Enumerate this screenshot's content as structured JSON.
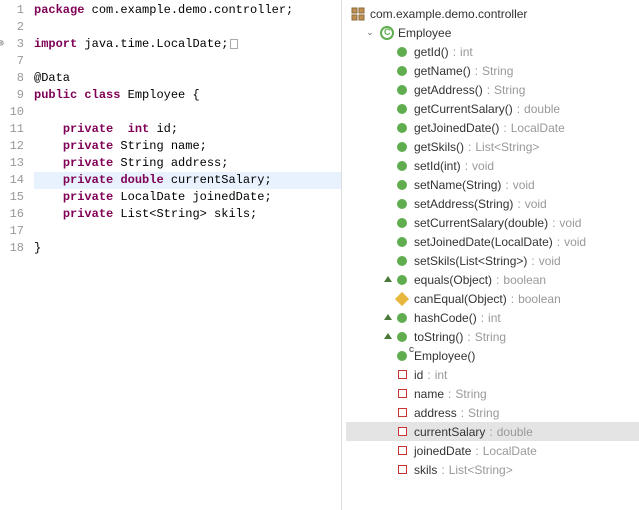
{
  "editor": {
    "lines": [
      {
        "n": "1",
        "tokens": [
          [
            "kw",
            "package"
          ],
          [
            "plain",
            " com.example.demo.controller;"
          ]
        ]
      },
      {
        "n": "2",
        "tokens": []
      },
      {
        "n": "3",
        "tokens": [
          [
            "kw",
            "import"
          ],
          [
            "plain",
            " java.time.LocalDate;"
          ]
        ],
        "import": true,
        "collapsed": true
      },
      {
        "n": "7",
        "tokens": []
      },
      {
        "n": "8",
        "tokens": [
          [
            "plain",
            "@Data"
          ]
        ]
      },
      {
        "n": "9",
        "tokens": [
          [
            "kw",
            "public"
          ],
          [
            "plain",
            " "
          ],
          [
            "kw",
            "class"
          ],
          [
            "plain",
            " Employee {"
          ]
        ]
      },
      {
        "n": "10",
        "tokens": []
      },
      {
        "n": "11",
        "tokens": [
          [
            "plain",
            "    "
          ],
          [
            "kw",
            "private"
          ],
          [
            "plain",
            "  "
          ],
          [
            "kw",
            "int"
          ],
          [
            "plain",
            " id;"
          ]
        ]
      },
      {
        "n": "12",
        "tokens": [
          [
            "plain",
            "    "
          ],
          [
            "kw",
            "private"
          ],
          [
            "plain",
            " String name;"
          ]
        ]
      },
      {
        "n": "13",
        "tokens": [
          [
            "plain",
            "    "
          ],
          [
            "kw",
            "private"
          ],
          [
            "plain",
            " String address;"
          ]
        ]
      },
      {
        "n": "14",
        "tokens": [
          [
            "plain",
            "    "
          ],
          [
            "kw",
            "private"
          ],
          [
            "plain",
            " "
          ],
          [
            "kw",
            "double"
          ],
          [
            "plain",
            " currentSalary;"
          ]
        ],
        "highlighted": true
      },
      {
        "n": "15",
        "tokens": [
          [
            "plain",
            "    "
          ],
          [
            "kw",
            "private"
          ],
          [
            "plain",
            " LocalDate joinedDate;"
          ]
        ]
      },
      {
        "n": "16",
        "tokens": [
          [
            "plain",
            "    "
          ],
          [
            "kw",
            "private"
          ],
          [
            "plain",
            " List<String> skils;"
          ]
        ]
      },
      {
        "n": "17",
        "tokens": []
      },
      {
        "n": "18",
        "tokens": [
          [
            "plain",
            "}"
          ]
        ]
      }
    ]
  },
  "outline": {
    "package": "com.example.demo.controller",
    "class": "Employee",
    "members": [
      {
        "icon": "method-public",
        "name": "getId()",
        "ret": "int"
      },
      {
        "icon": "method-public",
        "name": "getName()",
        "ret": "String"
      },
      {
        "icon": "method-public",
        "name": "getAddress()",
        "ret": "String"
      },
      {
        "icon": "method-public",
        "name": "getCurrentSalary()",
        "ret": "double"
      },
      {
        "icon": "method-public",
        "name": "getJoinedDate()",
        "ret": "LocalDate"
      },
      {
        "icon": "method-public",
        "name": "getSkils()",
        "ret": "List<String>"
      },
      {
        "icon": "method-public",
        "name": "setId(int)",
        "ret": "void"
      },
      {
        "icon": "method-public",
        "name": "setName(String)",
        "ret": "void"
      },
      {
        "icon": "method-public",
        "name": "setAddress(String)",
        "ret": "void"
      },
      {
        "icon": "method-public",
        "name": "setCurrentSalary(double)",
        "ret": "void"
      },
      {
        "icon": "method-public",
        "name": "setJoinedDate(LocalDate)",
        "ret": "void"
      },
      {
        "icon": "method-public",
        "name": "setSkils(List<String>)",
        "ret": "void"
      },
      {
        "icon": "method-public",
        "name": "equals(Object)",
        "ret": "boolean",
        "override": true
      },
      {
        "icon": "method-protected",
        "name": "canEqual(Object)",
        "ret": "boolean"
      },
      {
        "icon": "method-public",
        "name": "hashCode()",
        "ret": "int",
        "override": true
      },
      {
        "icon": "method-public",
        "name": "toString()",
        "ret": "String",
        "override": true
      },
      {
        "icon": "constructor",
        "name": "Employee()",
        "ret": ""
      },
      {
        "icon": "field",
        "name": "id",
        "ret": "int"
      },
      {
        "icon": "field",
        "name": "name",
        "ret": "String"
      },
      {
        "icon": "field",
        "name": "address",
        "ret": "String"
      },
      {
        "icon": "field",
        "name": "currentSalary",
        "ret": "double",
        "selected": true
      },
      {
        "icon": "field",
        "name": "joinedDate",
        "ret": "LocalDate"
      },
      {
        "icon": "field",
        "name": "skils",
        "ret": "List<String>"
      }
    ]
  }
}
